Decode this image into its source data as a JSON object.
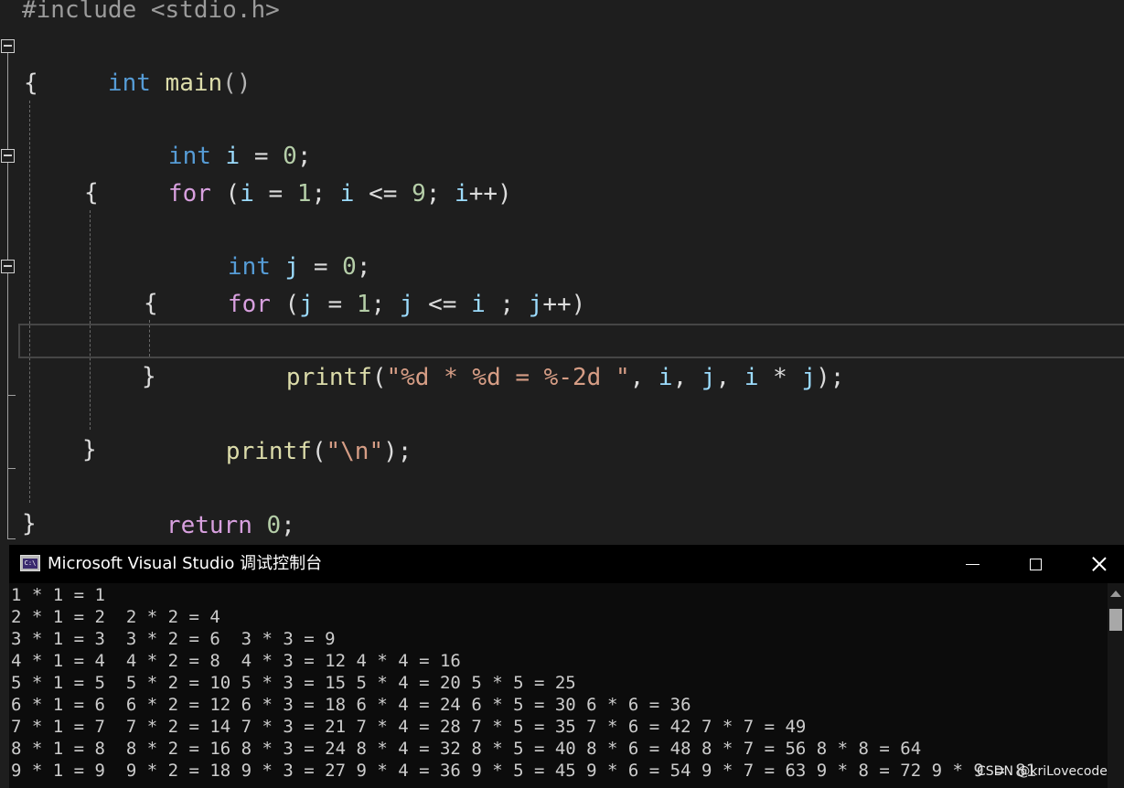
{
  "editor": {
    "lines": [
      "#include <stdio.h>",
      "int main()",
      "{",
      "int i = 0;",
      "for (i = 1; i <= 9; i++)",
      "{",
      "int j = 0;",
      "for (j = 1; j <= i ; j++)",
      "{",
      "printf(\"%d * %d = %-2d \", i, j, i * j);",
      "}",
      "printf(\"\\n\");",
      "}",
      "return 0;",
      "}"
    ]
  },
  "console": {
    "title": "Microsoft Visual Studio 调试控制台",
    "icon": "console-app-icon",
    "icon_text": "C:\\",
    "buttons": {
      "minimize": "minimize-icon",
      "maximize": "maximize-icon",
      "close": "close-icon"
    },
    "output": [
      "1 * 1 = 1",
      "2 * 1 = 2  2 * 2 = 4",
      "3 * 1 = 3  3 * 2 = 6  3 * 3 = 9",
      "4 * 1 = 4  4 * 2 = 8  4 * 3 = 12 4 * 4 = 16",
      "5 * 1 = 5  5 * 2 = 10 5 * 3 = 15 5 * 4 = 20 5 * 5 = 25",
      "6 * 1 = 6  6 * 2 = 12 6 * 3 = 18 6 * 4 = 24 6 * 5 = 30 6 * 6 = 36",
      "7 * 1 = 7  7 * 2 = 14 7 * 3 = 21 7 * 4 = 28 7 * 5 = 35 7 * 6 = 42 7 * 7 = 49",
      "8 * 1 = 8  8 * 2 = 16 8 * 3 = 24 8 * 4 = 32 8 * 5 = 40 8 * 6 = 48 8 * 7 = 56 8 * 8 = 64",
      "9 * 1 = 9  9 * 2 = 18 9 * 3 = 27 9 * 4 = 36 9 * 5 = 45 9 * 6 = 54 9 * 7 = 63 9 * 8 = 72 9 * 9 = 81"
    ]
  },
  "watermark": "CSDN @kriLovecode",
  "colors": {
    "editor_bg": "#1e1e1e",
    "keyword": "#569cd6",
    "control_keyword": "#d8a0df",
    "function": "#dcdcaa",
    "variable": "#9cdcfe",
    "number": "#b5cea8",
    "string": "#d69d85",
    "console_bg": "#0c0c0c"
  }
}
